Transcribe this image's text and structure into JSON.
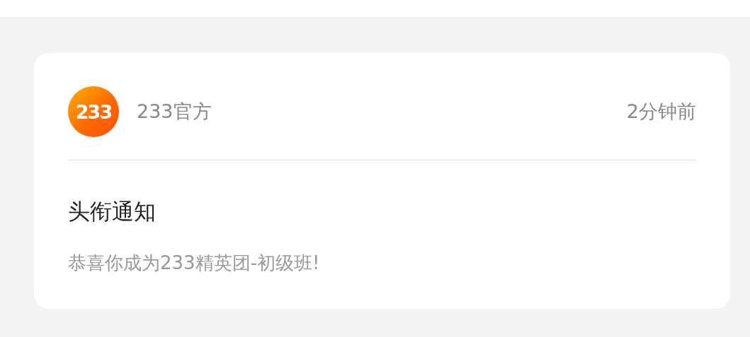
{
  "message": {
    "sender": {
      "logo_text": "233",
      "name": "233官方"
    },
    "time": "2分钟前",
    "title": "头衔通知",
    "body": "恭喜你成为233精英团-初级班!"
  }
}
